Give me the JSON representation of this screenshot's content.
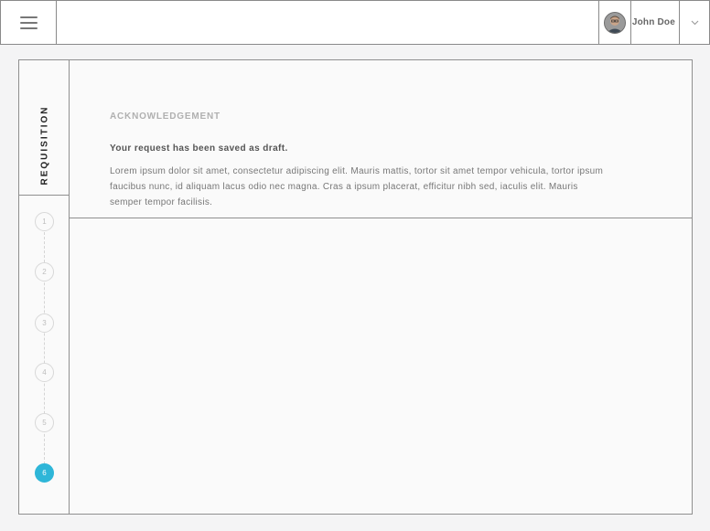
{
  "header": {
    "menu_icon": "hamburger-icon",
    "user": {
      "name": "John Doe",
      "avatar_icon": "user-avatar",
      "dropdown_icon": "chevron-down-icon"
    }
  },
  "stepper": {
    "title": "REQUISITION",
    "steps": [
      "1",
      "2",
      "3",
      "4",
      "5",
      "6"
    ],
    "active_step": "6",
    "active_color": "#2eb6d8"
  },
  "content": {
    "section_title": "ACKNOWLEDGEMENT",
    "message_title": "Your request has been saved as draft.",
    "message_body": "Lorem ipsum dolor sit amet, consectetur adipiscing elit. Mauris mattis, tortor sit amet tempor vehicula, tortor ipsum faucibus nunc, id aliquam lacus odio nec magna. Cras a ipsum placerat, efficitur nibh sed, iaculis elit. Mauris semper tempor facilisis."
  }
}
